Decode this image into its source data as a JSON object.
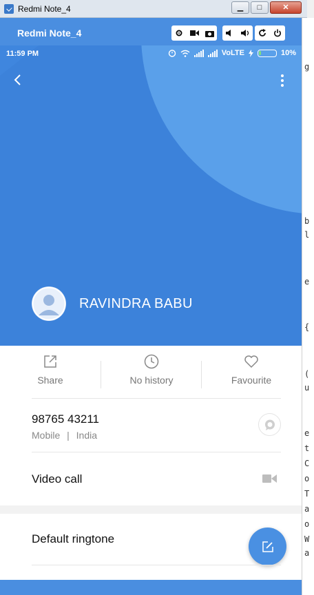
{
  "window": {
    "title": "Redmi Note_4",
    "min_label": "▁",
    "max_label": "□",
    "close_label": "✕"
  },
  "emulator": {
    "device_name": "Redmi Note_4",
    "controls": [
      "settings-icon",
      "video-record-icon",
      "camera-icon",
      "volume-down-icon",
      "volume-up-icon",
      "rotate-icon",
      "power-icon"
    ]
  },
  "status_bar": {
    "time": "11:59 PM",
    "network": "VoLTE",
    "battery": "10%"
  },
  "contact": {
    "name": "RAVINDRA BABU"
  },
  "actions": {
    "share": "Share",
    "history": "No history",
    "favourite": "Favourite"
  },
  "phone": {
    "number": "98765 43211",
    "type": "Mobile",
    "separator": "|",
    "country": "India"
  },
  "video_call": {
    "label": "Video call"
  },
  "ringtone": {
    "label": "Default ringtone"
  },
  "colors": {
    "accent": "#4a8ee0",
    "hero_blue": "#3f86de",
    "fab_blue": "#4a90e2"
  },
  "background_editor_glyphs": [
    "g",
    "b",
    "l",
    "e",
    "{",
    "(",
    "u",
    "e",
    "t",
    "C",
    "o",
    "T",
    "a",
    "o",
    "W",
    "a"
  ]
}
